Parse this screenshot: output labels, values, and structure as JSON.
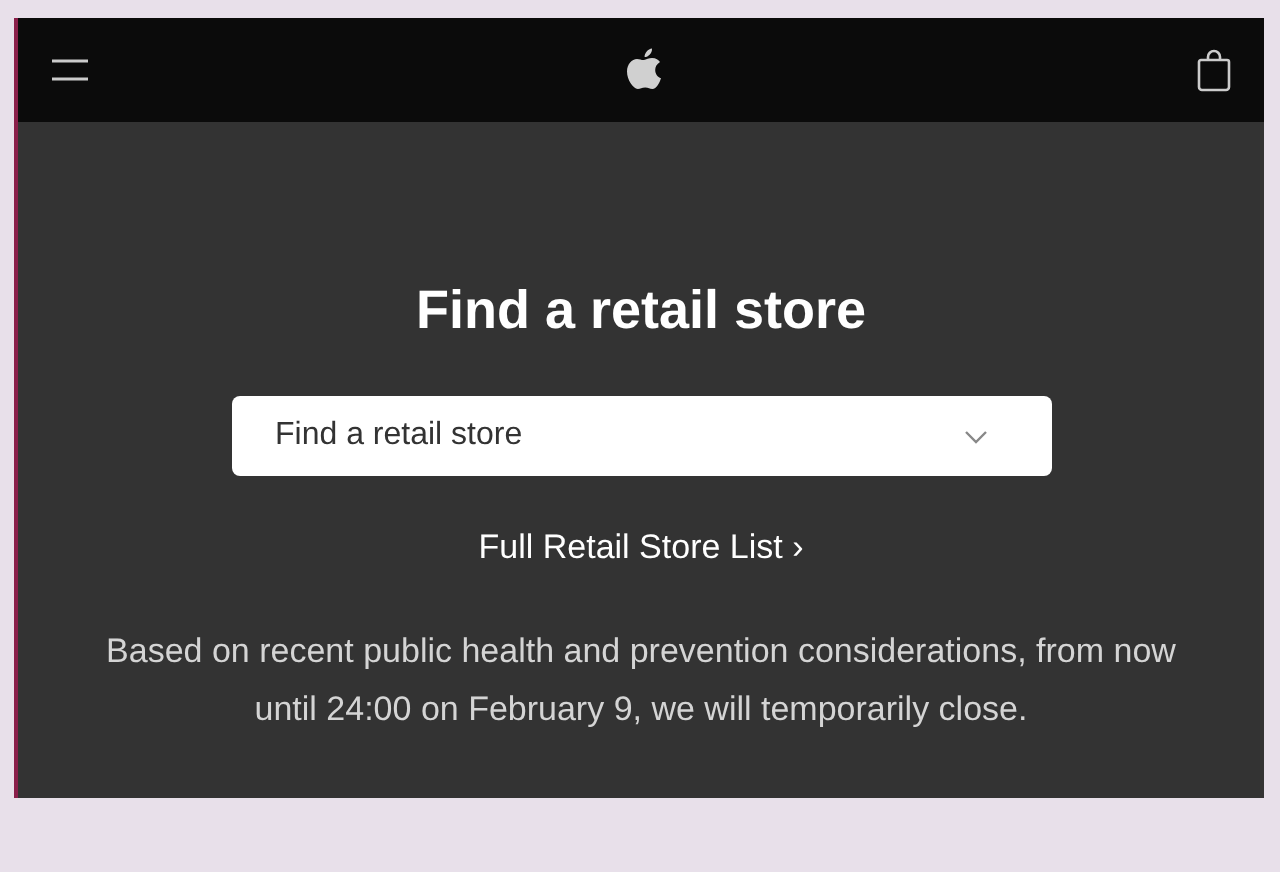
{
  "title": "Find a retail store",
  "dropdown": {
    "value": "Find a retail store"
  },
  "link": {
    "label": "Full Retail Store List",
    "arrow": "›"
  },
  "notice": "Based on recent public health and prevention considerations, from now until 24:00 on February 9, we will temporarily close."
}
